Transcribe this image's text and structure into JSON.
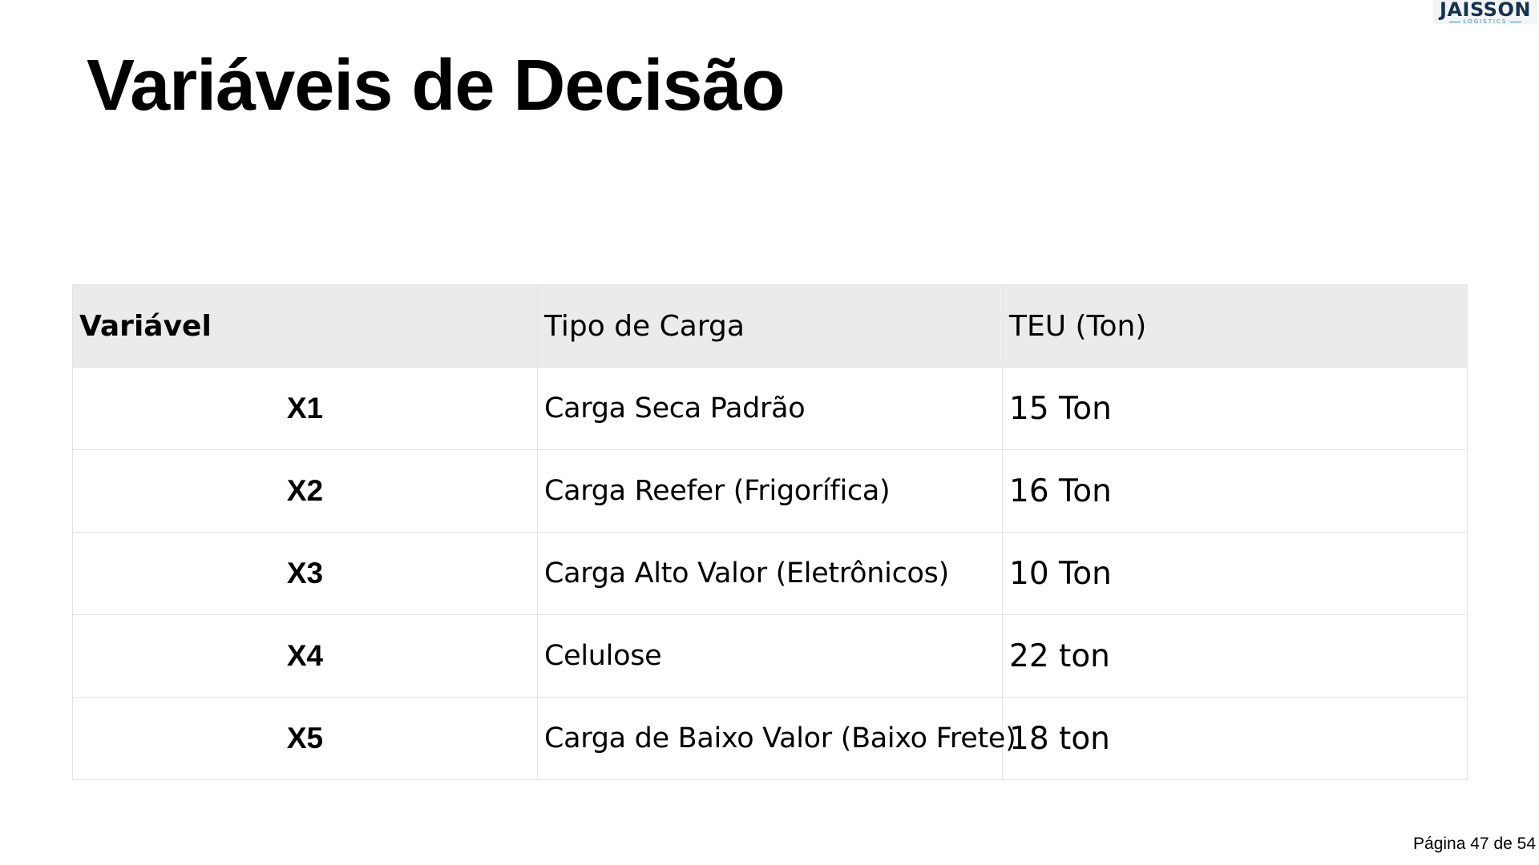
{
  "logo": {
    "name": "JAISSON",
    "tagline": "LOGISTICS"
  },
  "title": "Variáveis de Decisão",
  "table": {
    "headers": [
      "Variável",
      "Tipo de Carga",
      "TEU (Ton)"
    ],
    "rows": [
      [
        "X1",
        "Carga Seca Padrão",
        "15 Ton"
      ],
      [
        "X2",
        "Carga Reefer (Frigorífica)",
        "16 Ton"
      ],
      [
        "X3",
        "Carga Alto Valor (Eletrônicos)",
        "10 Ton"
      ],
      [
        "X4",
        "Celulose",
        "22 ton"
      ],
      [
        "X5",
        "Carga de Baixo Valor (Baixo Frete)",
        "18 ton"
      ]
    ]
  },
  "footer": {
    "page_label": "Página 47 de 54"
  }
}
